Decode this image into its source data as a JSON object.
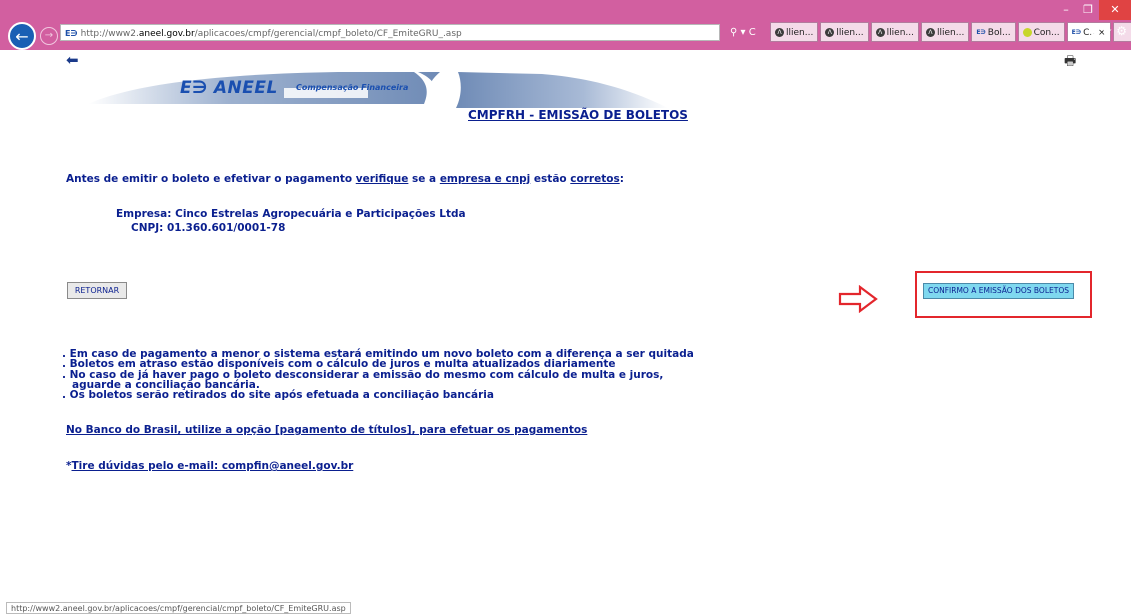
{
  "browser": {
    "address_favicon": "E∋",
    "address_prefix": "http://www2.",
    "address_host": "aneel.gov.br",
    "address_path": "/aplicacoes/cmpf/gerencial/cmpf_boleto/CF_EmiteGRU_.asp",
    "search_refresh": "⚲ ▾ C",
    "tabs": [
      {
        "icon": "lien-icon",
        "label": "llien..."
      },
      {
        "icon": "lien-icon",
        "label": "llien..."
      },
      {
        "icon": "lien-icon",
        "label": "llien..."
      },
      {
        "icon": "lien-icon",
        "label": "llien..."
      },
      {
        "icon": "aneel-icon",
        "label": "Bol..."
      },
      {
        "icon": "con-icon",
        "label": "Con..."
      },
      {
        "icon": "aneel-icon",
        "label": "C.. ×"
      }
    ]
  },
  "logo": {
    "brand": "ANEEL",
    "mark": "E∋",
    "subtitle": "Compensação Financeira"
  },
  "page": {
    "title": "CMPFRH - EMISSÃO DE BOLETOS",
    "intro": {
      "part1": "Antes de emitir o boleto e efetivar o pagamento ",
      "link1": "verifique",
      "part2": " se a ",
      "link2": "empresa e cnpj",
      "part3": " estão ",
      "link3": "corretos",
      "part4": ":"
    },
    "company": "Empresa:  Cinco Estrelas Agropecuária e Participações Ltda",
    "cnpj": "CNPJ:  01.360.601/0001-78",
    "buttons": {
      "retornar": "RETORNAR",
      "confirm": "CONFIRMO A EMISSÃO DOS BOLETOS"
    },
    "notes": [
      ". Em caso de pagamento a menor o sistema estará emitindo um novo boleto com a diferença a ser quitada",
      ". Boletos em atraso estão disponíveis com o cálculo de juros e multa atualizados diariamente",
      ". No caso de já haver pago o boleto desconsiderar a emissão do mesmo com cálculo de multa e juros,",
      "aguarde a conciliação bancária.",
      ". Os boletos serão retirados do site após efetuada a conciliação bancária"
    ],
    "bb_link": "No Banco do Brasil, utilize a opção [pagamento de títulos], para efetuar os pagamentos",
    "email_prefix": "*",
    "email_link": "Tire dúvidas pelo e-mail: compfin@aneel.gov.br"
  },
  "status_bar": "http://www2.aneel.gov.br/aplicacoes/cmpf/gerencial/cmpf_boleto/CF_EmiteGRU.asp",
  "colors": {
    "chrome": "#d25fa0",
    "text": "#0a1f8f",
    "confirm_bg": "#7fd8ef",
    "highlight": "#e3262c"
  }
}
